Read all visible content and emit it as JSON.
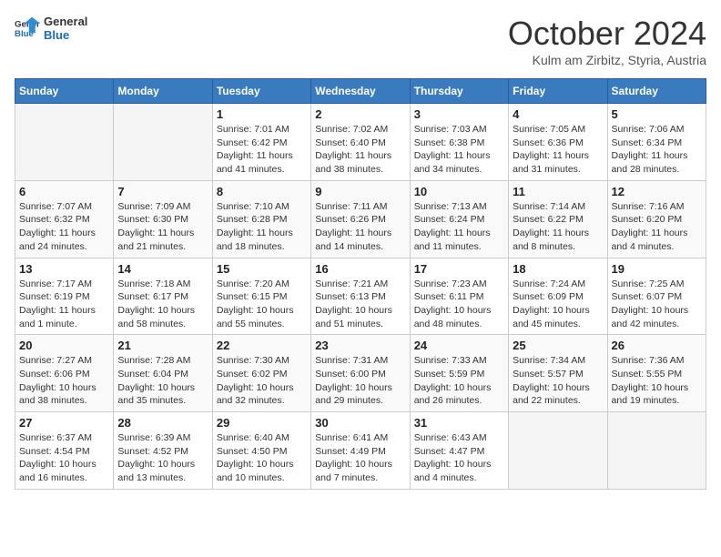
{
  "header": {
    "logo_line1": "General",
    "logo_line2": "Blue",
    "month": "October 2024",
    "location": "Kulm am Zirbitz, Styria, Austria"
  },
  "weekdays": [
    "Sunday",
    "Monday",
    "Tuesday",
    "Wednesday",
    "Thursday",
    "Friday",
    "Saturday"
  ],
  "weeks": [
    [
      {
        "day": "",
        "info": ""
      },
      {
        "day": "",
        "info": ""
      },
      {
        "day": "1",
        "info": "Sunrise: 7:01 AM\nSunset: 6:42 PM\nDaylight: 11 hours and 41 minutes."
      },
      {
        "day": "2",
        "info": "Sunrise: 7:02 AM\nSunset: 6:40 PM\nDaylight: 11 hours and 38 minutes."
      },
      {
        "day": "3",
        "info": "Sunrise: 7:03 AM\nSunset: 6:38 PM\nDaylight: 11 hours and 34 minutes."
      },
      {
        "day": "4",
        "info": "Sunrise: 7:05 AM\nSunset: 6:36 PM\nDaylight: 11 hours and 31 minutes."
      },
      {
        "day": "5",
        "info": "Sunrise: 7:06 AM\nSunset: 6:34 PM\nDaylight: 11 hours and 28 minutes."
      }
    ],
    [
      {
        "day": "6",
        "info": "Sunrise: 7:07 AM\nSunset: 6:32 PM\nDaylight: 11 hours and 24 minutes."
      },
      {
        "day": "7",
        "info": "Sunrise: 7:09 AM\nSunset: 6:30 PM\nDaylight: 11 hours and 21 minutes."
      },
      {
        "day": "8",
        "info": "Sunrise: 7:10 AM\nSunset: 6:28 PM\nDaylight: 11 hours and 18 minutes."
      },
      {
        "day": "9",
        "info": "Sunrise: 7:11 AM\nSunset: 6:26 PM\nDaylight: 11 hours and 14 minutes."
      },
      {
        "day": "10",
        "info": "Sunrise: 7:13 AM\nSunset: 6:24 PM\nDaylight: 11 hours and 11 minutes."
      },
      {
        "day": "11",
        "info": "Sunrise: 7:14 AM\nSunset: 6:22 PM\nDaylight: 11 hours and 8 minutes."
      },
      {
        "day": "12",
        "info": "Sunrise: 7:16 AM\nSunset: 6:20 PM\nDaylight: 11 hours and 4 minutes."
      }
    ],
    [
      {
        "day": "13",
        "info": "Sunrise: 7:17 AM\nSunset: 6:19 PM\nDaylight: 11 hours and 1 minute."
      },
      {
        "day": "14",
        "info": "Sunrise: 7:18 AM\nSunset: 6:17 PM\nDaylight: 10 hours and 58 minutes."
      },
      {
        "day": "15",
        "info": "Sunrise: 7:20 AM\nSunset: 6:15 PM\nDaylight: 10 hours and 55 minutes."
      },
      {
        "day": "16",
        "info": "Sunrise: 7:21 AM\nSunset: 6:13 PM\nDaylight: 10 hours and 51 minutes."
      },
      {
        "day": "17",
        "info": "Sunrise: 7:23 AM\nSunset: 6:11 PM\nDaylight: 10 hours and 48 minutes."
      },
      {
        "day": "18",
        "info": "Sunrise: 7:24 AM\nSunset: 6:09 PM\nDaylight: 10 hours and 45 minutes."
      },
      {
        "day": "19",
        "info": "Sunrise: 7:25 AM\nSunset: 6:07 PM\nDaylight: 10 hours and 42 minutes."
      }
    ],
    [
      {
        "day": "20",
        "info": "Sunrise: 7:27 AM\nSunset: 6:06 PM\nDaylight: 10 hours and 38 minutes."
      },
      {
        "day": "21",
        "info": "Sunrise: 7:28 AM\nSunset: 6:04 PM\nDaylight: 10 hours and 35 minutes."
      },
      {
        "day": "22",
        "info": "Sunrise: 7:30 AM\nSunset: 6:02 PM\nDaylight: 10 hours and 32 minutes."
      },
      {
        "day": "23",
        "info": "Sunrise: 7:31 AM\nSunset: 6:00 PM\nDaylight: 10 hours and 29 minutes."
      },
      {
        "day": "24",
        "info": "Sunrise: 7:33 AM\nSunset: 5:59 PM\nDaylight: 10 hours and 26 minutes."
      },
      {
        "day": "25",
        "info": "Sunrise: 7:34 AM\nSunset: 5:57 PM\nDaylight: 10 hours and 22 minutes."
      },
      {
        "day": "26",
        "info": "Sunrise: 7:36 AM\nSunset: 5:55 PM\nDaylight: 10 hours and 19 minutes."
      }
    ],
    [
      {
        "day": "27",
        "info": "Sunrise: 6:37 AM\nSunset: 4:54 PM\nDaylight: 10 hours and 16 minutes."
      },
      {
        "day": "28",
        "info": "Sunrise: 6:39 AM\nSunset: 4:52 PM\nDaylight: 10 hours and 13 minutes."
      },
      {
        "day": "29",
        "info": "Sunrise: 6:40 AM\nSunset: 4:50 PM\nDaylight: 10 hours and 10 minutes."
      },
      {
        "day": "30",
        "info": "Sunrise: 6:41 AM\nSunset: 4:49 PM\nDaylight: 10 hours and 7 minutes."
      },
      {
        "day": "31",
        "info": "Sunrise: 6:43 AM\nSunset: 4:47 PM\nDaylight: 10 hours and 4 minutes."
      },
      {
        "day": "",
        "info": ""
      },
      {
        "day": "",
        "info": ""
      }
    ]
  ]
}
